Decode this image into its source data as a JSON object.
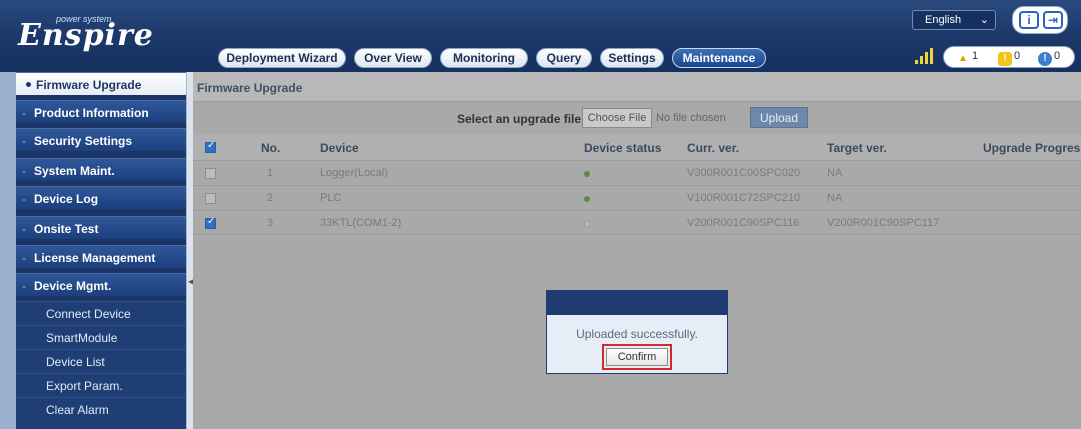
{
  "header": {
    "brand": "Enspire",
    "tagline": "power system",
    "language": "English",
    "tabs": [
      "Deployment Wizard",
      "Over View",
      "Monitoring",
      "Query",
      "Settings",
      "Maintenance"
    ],
    "active_tab": "Maintenance",
    "alarms": {
      "major": "1",
      "minor": "0",
      "warning": "0"
    }
  },
  "sidebar": {
    "items": [
      "Firmware Upgrade",
      "Product Information",
      "Security Settings",
      "System Maint.",
      "Device Log",
      "Onsite Test",
      "License Management",
      "Device Mgmt."
    ],
    "sub_items": [
      "Connect Device",
      "SmartModule",
      "Device List",
      "Export Param.",
      "Clear Alarm"
    ]
  },
  "main": {
    "title": "Firmware Upgrade",
    "upload_label": "Select an upgrade file:",
    "choose_file": "Choose File",
    "no_file": "No file chosen",
    "upload_button": "Upload",
    "columns": [
      "No.",
      "Device",
      "Device status",
      "Curr. ver.",
      "Target ver.",
      "Upgrade Progress"
    ],
    "rows": [
      {
        "checked": false,
        "no": "1",
        "device": "Logger(Local)",
        "status": "online",
        "curr": "V300R001C00SPC020",
        "target": "NA"
      },
      {
        "checked": false,
        "no": "2",
        "device": "PLC",
        "status": "online",
        "curr": "V100R001C72SPC210",
        "target": "NA"
      },
      {
        "checked": true,
        "no": "3",
        "device": "33KTL(COM1-2)",
        "status": "offline",
        "curr": "V200R001C90SPC116",
        "target": "V200R001C90SPC117"
      }
    ]
  },
  "dialog": {
    "message": "Uploaded successfully.",
    "confirm": "Confirm"
  }
}
